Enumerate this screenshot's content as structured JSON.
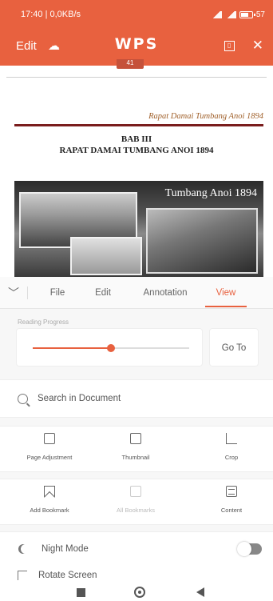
{
  "status_bar": {
    "time_text": "17:40 | 0,0KB/s",
    "battery_percent": "57"
  },
  "app_bar": {
    "edit_label": "Edit",
    "logo_text": "WPS",
    "page_badge": "41"
  },
  "document": {
    "running_head": "Rapat Damai Tumbang Anoi 1894",
    "chapter_number": "BAB III",
    "chapter_title": "RAPAT DAMAI TUMBANG ANOI 1894",
    "image_caption": "Tumbang Anoi 1894"
  },
  "menu": {
    "tabs": [
      {
        "label": "File",
        "active": false
      },
      {
        "label": "Edit",
        "active": false
      },
      {
        "label": "Annotation",
        "active": false
      },
      {
        "label": "View",
        "active": true
      }
    ]
  },
  "reading_progress": {
    "label": "Reading Progress",
    "value_fraction": 0.5,
    "goto_label": "Go To"
  },
  "search": {
    "label": "Search in Document"
  },
  "tools_row1": [
    {
      "label": "Page Adjustment",
      "icon": "page-adjustment-icon"
    },
    {
      "label": "Thumbnail",
      "icon": "thumbnail-icon"
    },
    {
      "label": "Crop",
      "icon": "crop-icon"
    }
  ],
  "tools_row2": [
    {
      "label": "Add Bookmark",
      "icon": "add-bookmark-icon",
      "disabled": false
    },
    {
      "label": "All Bookmarks",
      "icon": "all-bookmarks-icon",
      "disabled": true
    },
    {
      "label": "Content",
      "icon": "content-icon",
      "disabled": false
    }
  ],
  "settings": {
    "night_mode_label": "Night Mode",
    "night_mode_on": false,
    "rotate_label": "Rotate Screen"
  },
  "colors": {
    "accent": "#e8613f",
    "chapter_rule": "#7a1d1d",
    "running_head": "#a0602a"
  }
}
